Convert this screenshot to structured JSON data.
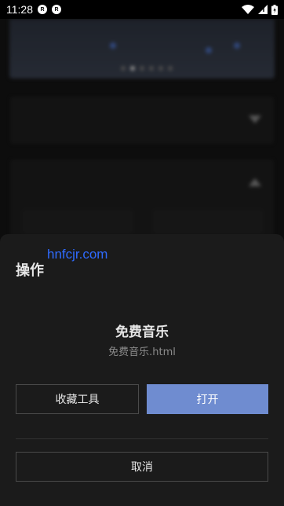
{
  "status_bar": {
    "time": "11:28",
    "notification_badges": [
      "R",
      "R"
    ]
  },
  "watermark": "hnfcjr.com",
  "sheet": {
    "title": "操作",
    "app_name": "免费音乐",
    "app_file": "免费音乐.html",
    "favorite_button": "收藏工具",
    "open_button": "打开",
    "cancel_button": "取消"
  },
  "colors": {
    "accent": "#6f8cd0",
    "background": "#141414",
    "sheet": "#1b1b1b",
    "watermark": "#2f6bff"
  }
}
